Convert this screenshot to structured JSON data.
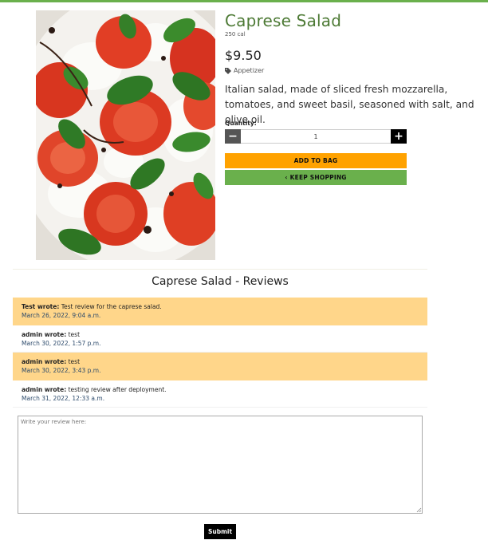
{
  "product": {
    "name": "Caprese Salad",
    "calories": "250 cal",
    "price": "$9.50",
    "category": "Appetizer",
    "description": "Italian salad, made of sliced fresh mozzarella, tomatoes, and sweet basil, seasoned with salt, and olive oil.",
    "image_icon": "caprese-salad-photo"
  },
  "quantity": {
    "label": "Quantity:",
    "value": "1",
    "minus_symbol": "−",
    "plus_symbol": "+"
  },
  "actions": {
    "add_to_bag": "ADD TO BAG",
    "keep_shopping": "KEEP SHOPPING",
    "keep_shopping_icon": "‹"
  },
  "reviews": {
    "title": "Caprese Salad - Reviews",
    "items": [
      {
        "author": "Test wrote:",
        "text": "Test review for the caprese salad.",
        "date": "March 26, 2022, 9:04 a.m."
      },
      {
        "author": "admin wrote:",
        "text": "test",
        "date": "March 30, 2022, 1:57 p.m."
      },
      {
        "author": "admin wrote:",
        "text": "test",
        "date": "March 30, 2022, 3:43 p.m."
      },
      {
        "author": "admin wrote:",
        "text": "testing review after deployment.",
        "date": "March 31, 2022, 12:33 a.m."
      }
    ]
  },
  "review_form": {
    "placeholder": "Write your review here:",
    "submit_label": "Submit"
  },
  "colors": {
    "brand_green": "#6ab04c",
    "title_green": "#4d7a35",
    "orange": "#ffa200",
    "review_highlight": "#ffd68a"
  }
}
